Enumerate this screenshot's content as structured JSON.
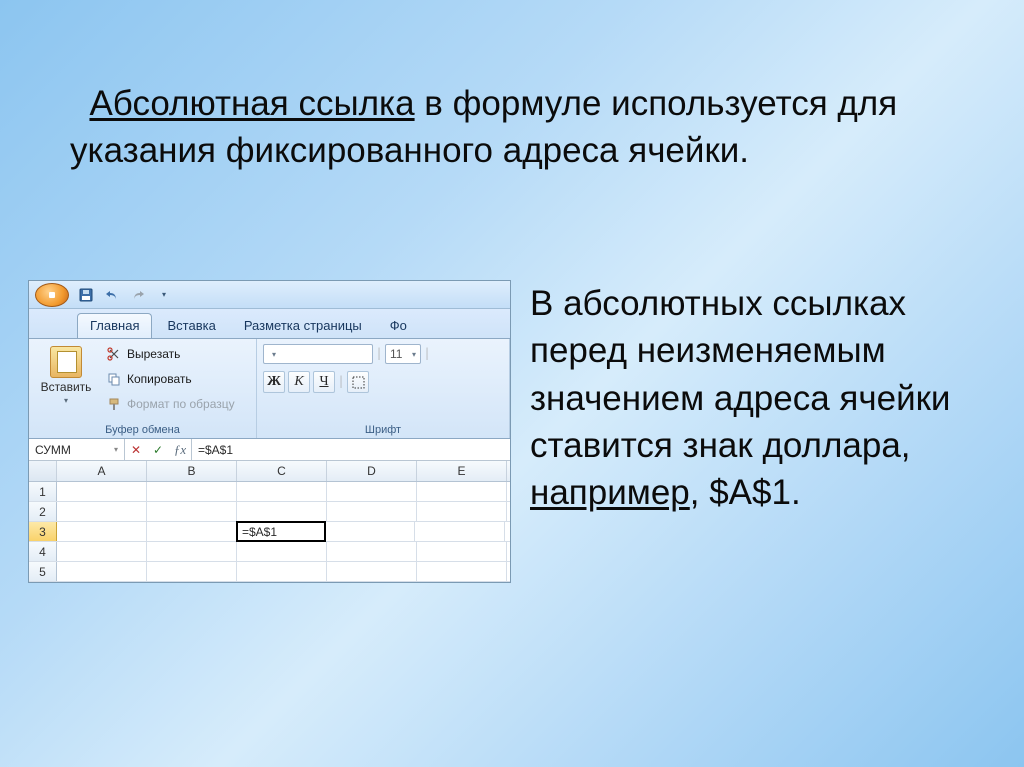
{
  "para1": {
    "underlined": "Абсолютная ссылка",
    "rest": " в формуле используется для указания фиксированного адреса ячейки."
  },
  "para2": {
    "t1": "В абсолютных ссылках перед неизменяемым значением адреса ячейки ставится знак доллара, ",
    "u": "например",
    "t2": ", $A$1."
  },
  "excel": {
    "tabs": {
      "home": "Главная",
      "insert": "Вставка",
      "layout": "Разметка страницы",
      "formulas": "Фо"
    },
    "clipboard": {
      "paste": "Вставить",
      "cut": "Вырезать",
      "copy": "Копировать",
      "format_painter": "Формат по образцу",
      "group": "Буфер обмена"
    },
    "font": {
      "size": "11",
      "bold": "Ж",
      "italic": "К",
      "underline": "Ч",
      "group": "Шрифт"
    },
    "formula_bar": {
      "name": "СУММ",
      "formula": "=$A$1"
    },
    "columns": [
      "A",
      "B",
      "C",
      "D",
      "E"
    ],
    "rows": [
      "1",
      "2",
      "3",
      "4",
      "5"
    ],
    "active_cell_value": "=$A$1"
  }
}
